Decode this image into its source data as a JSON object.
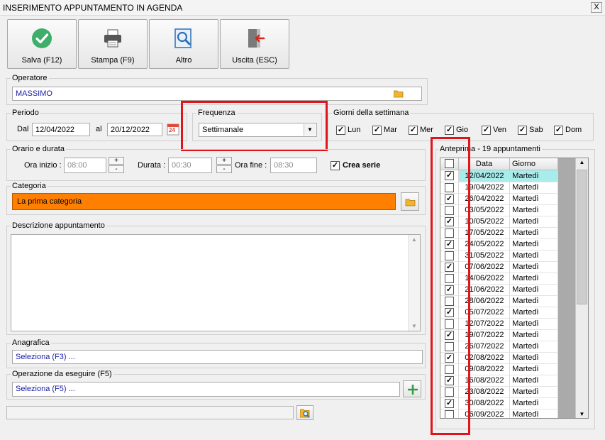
{
  "window": {
    "title": "INSERIMENTO APPUNTAMENTO IN AGENDA",
    "close_label": "X"
  },
  "toolbar": {
    "save": "Salva (F12)",
    "print": "Stampa (F9)",
    "other": "Altro",
    "exit": "Uscita (ESC)"
  },
  "operatore": {
    "label": "Operatore",
    "value": "MASSIMO"
  },
  "periodo": {
    "label": "Periodo",
    "dal_label": "Dal",
    "dal": "12/04/2022",
    "al_label": "al",
    "al": "20/12/2022",
    "calendar_day": "24"
  },
  "frequenza": {
    "label": "Frequenza",
    "value": "Settimanale"
  },
  "giorni": {
    "label": "Giorni della settimana",
    "days": [
      {
        "name": "Lun",
        "checked": true
      },
      {
        "name": "Mar",
        "checked": true
      },
      {
        "name": "Mer",
        "checked": true
      },
      {
        "name": "Gio",
        "checked": true
      },
      {
        "name": "Ven",
        "checked": true
      },
      {
        "name": "Sab",
        "checked": true
      },
      {
        "name": "Dom",
        "checked": true
      }
    ]
  },
  "orario": {
    "label": "Orario e durata",
    "inizio_label": "Ora inizio :",
    "inizio": "08:00",
    "durata_label": "Durata :",
    "durata": "00:30",
    "fine_label": "Ora fine :",
    "fine": "08:30",
    "plus": "+",
    "minus": "-",
    "crea_serie": "Crea serie",
    "crea_serie_checked": true
  },
  "categoria": {
    "label": "Categoria",
    "value": "La prima categoria",
    "color": "#ff8000"
  },
  "descrizione": {
    "label": "Descrizione appuntamento",
    "value": ""
  },
  "anagrafica": {
    "label": "Anagrafica",
    "value": "Seleziona (F3) ..."
  },
  "operazione": {
    "label": "Operazione da eseguire (F5)",
    "value": "Seleziona (F5) ..."
  },
  "bottom": {
    "value": ""
  },
  "anteprima": {
    "label": "Anteprima - 19 appuntamenti",
    "col_date": "Data",
    "col_day": "Giorno",
    "rows": [
      {
        "checked": true,
        "date": "12/04/2022",
        "day": "Martedì"
      },
      {
        "checked": false,
        "date": "19/04/2022",
        "day": "Martedì"
      },
      {
        "checked": true,
        "date": "26/04/2022",
        "day": "Martedì"
      },
      {
        "checked": false,
        "date": "03/05/2022",
        "day": "Martedì"
      },
      {
        "checked": true,
        "date": "10/05/2022",
        "day": "Martedì"
      },
      {
        "checked": false,
        "date": "17/05/2022",
        "day": "Martedì"
      },
      {
        "checked": true,
        "date": "24/05/2022",
        "day": "Martedì"
      },
      {
        "checked": false,
        "date": "31/05/2022",
        "day": "Martedì"
      },
      {
        "checked": true,
        "date": "07/06/2022",
        "day": "Martedì"
      },
      {
        "checked": false,
        "date": "14/06/2022",
        "day": "Martedì"
      },
      {
        "checked": true,
        "date": "21/06/2022",
        "day": "Martedì"
      },
      {
        "checked": false,
        "date": "28/06/2022",
        "day": "Martedì"
      },
      {
        "checked": true,
        "date": "05/07/2022",
        "day": "Martedì"
      },
      {
        "checked": false,
        "date": "12/07/2022",
        "day": "Martedì"
      },
      {
        "checked": true,
        "date": "19/07/2022",
        "day": "Martedì"
      },
      {
        "checked": false,
        "date": "26/07/2022",
        "day": "Martedì"
      },
      {
        "checked": true,
        "date": "02/08/2022",
        "day": "Martedì"
      },
      {
        "checked": false,
        "date": "09/08/2022",
        "day": "Martedì"
      },
      {
        "checked": true,
        "date": "16/08/2022",
        "day": "Martedì"
      },
      {
        "checked": false,
        "date": "23/08/2022",
        "day": "Martedì"
      },
      {
        "checked": true,
        "date": "30/08/2022",
        "day": "Martedì"
      },
      {
        "checked": false,
        "date": "06/09/2022",
        "day": "Martedì"
      }
    ]
  }
}
